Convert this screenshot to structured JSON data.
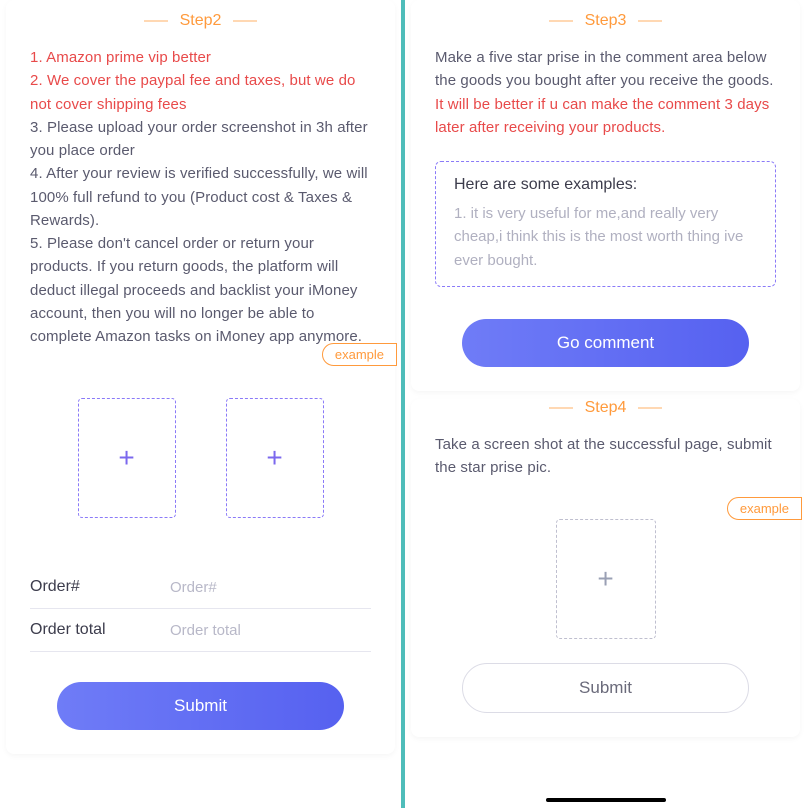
{
  "step2": {
    "title": "Step2",
    "lines": {
      "l1": "1. Amazon prime vip better",
      "l2": "2. We cover the paypal fee and taxes, but we do not cover shipping fees",
      "l3": "3. Please upload your order screenshot in 3h after you place order",
      "l4": "4. After your review is verified successfully, we will 100% full refund to you (Product cost & Taxes & Rewards).",
      "l5": "5. Please don't cancel order or return your products. If you return goods, the platform will deduct illegal proceeds and backlist your iMoney account, then you will no longer be able to complete Amazon tasks on iMoney app anymore."
    },
    "example_tag": "example",
    "fields": {
      "order_label": "Order#",
      "order_placeholder": "Order#",
      "total_label": "Order total",
      "total_placeholder": "Order total"
    },
    "submit": "Submit"
  },
  "step3": {
    "title": "Step3",
    "body_plain": "Make a five star prise in the comment area below the goods you bought after you receive the goods. ",
    "body_accent": "It will be better if u can make the comment 3 days later after receiving your products.",
    "examples_title": "Here are some examples:",
    "examples_body": "1. it is very useful for me,and really very cheap,i think this is the most worth thing ive ever bought.",
    "go_button": "Go comment"
  },
  "step4": {
    "title": "Step4",
    "body": "Take a screen shot at the successful page, submit the star prise pic.",
    "example_tag": "example",
    "submit": "Submit"
  },
  "icons": {
    "plus": "+"
  }
}
